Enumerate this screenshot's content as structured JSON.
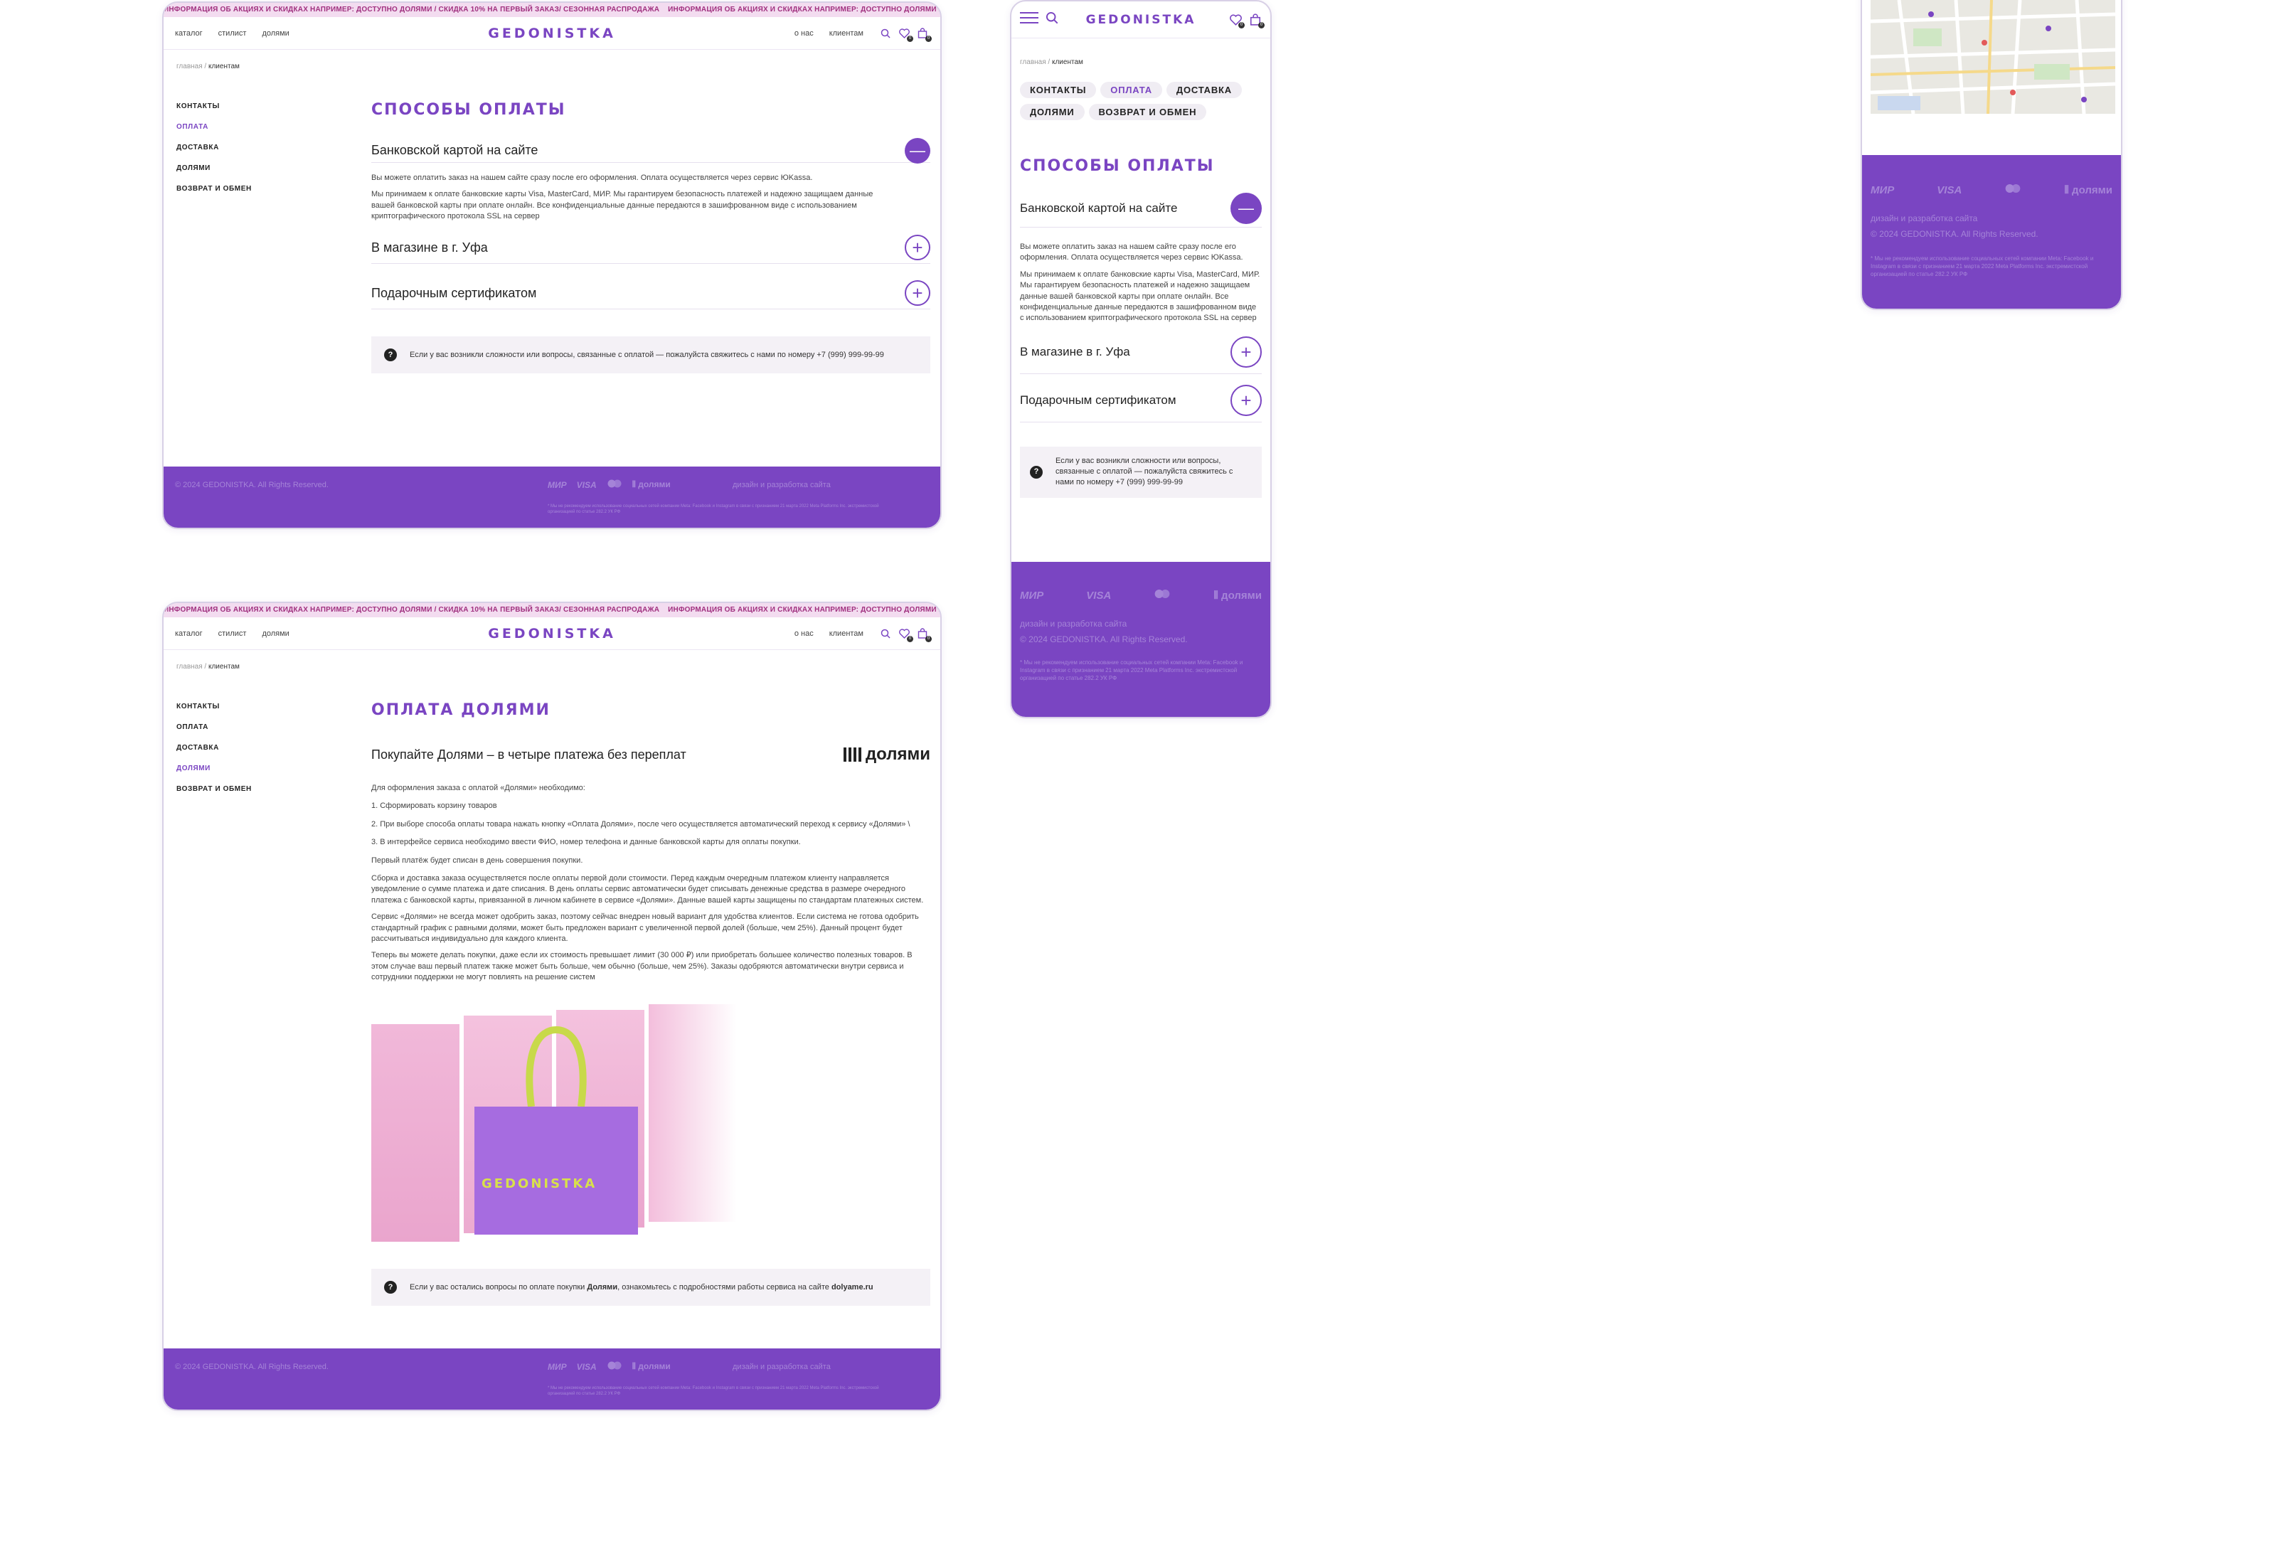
{
  "ticker": {
    "text": "ИНФОРМАЦИЯ ОБ АКЦИЯХ И СКИДКАХ НАПРИМЕР: ДОСТУПНО ДОЛЯМИ / СКИДКА 10% НА ПЕРВЫЙ ЗАКАЗ/ СЕЗОННАЯ РАСПРОДАЖА"
  },
  "header": {
    "logo": "GEDONISTKA",
    "nav": [
      "каталог",
      "стилист",
      "долями"
    ],
    "right_nav": [
      "о нас",
      "клиентам"
    ],
    "wishlist_count": "0",
    "cart_count": "0"
  },
  "breadcrumb": {
    "home": "главная /",
    "current": "клиентам"
  },
  "sidebar": [
    "КОНТАКТЫ",
    "ОПЛАТА",
    "ДОСТАВКА",
    "ДОЛЯМИ",
    "ВОЗВРАТ И ОБМЕН"
  ],
  "payment": {
    "title": "СПОСОБЫ ОПЛАТЫ",
    "acc1_title": "Банковской картой на сайте",
    "acc1_p1": "Вы можете оплатить заказ на нашем сайте сразу после его оформления. Оплата осуществляется через сервис ЮKassa.",
    "acc1_p2": "Мы принимаем к оплате банковские карты Visa, MasterCard, МИР. Мы гарантируем безопасность платежей и надежно защищаем данные вашей банковской карты при оплате онлайн. Все конфиденциальные данные передаются в зашифрованном виде с использованием криптографического протокола SSL на сервер",
    "acc2_title": "В магазине в г. Уфа",
    "acc3_title": "Подарочным  сертификатом",
    "note": "Если у вас возникли сложности или вопросы, связанные с оплатой — пожалуйста свяжитесь с нами по номеру +7 (999) 999-99-99"
  },
  "dolyami": {
    "title": "ОПЛАТА ДОЛЯМИ",
    "subtitle": "Покупайте Долями – в четыре платежа без переплат",
    "logo": "долями",
    "p1": "Для оформления заказа с оплатой «Долями» необходимо:",
    "p2": "1. Сформировать корзину товаров",
    "p3": "2. При выборе способа оплаты товара нажать кнопку «Оплата Долями», после чего осуществляется автоматический переход к сервису «Долями» \\",
    "p4": "3. В интерфейсе сервиса необходимо ввести ФИО, номер телефона и данные банковской карты для оплаты покупки.",
    "p5": "Первый платёж будет списан в день совершения покупки.",
    "p6": "Сборка и доставка заказа осуществляется после оплаты первой доли стоимости. Перед каждым очередным платежом клиенту направляется уведомление о сумме платежа и дате списания. В день оплаты сервис автоматически будет списывать денежные средства в размере очередного платежа с банковской карты, привязанной в личном кабинете в сервисе «Долями». Данные вашей карты защищены по стандартам платежных систем.",
    "p7": "Сервис «Долями» не всегда может одобрить заказ, поэтому сейчас внедрен новый вариант для удобства клиентов. Если система не готова одобрить стандартный график с равными долями, может быть предложен вариант с увеличенной первой долей (больше, чем 25%). Данный процент будет рассчитываться индивидуально для каждого клиента.",
    "p8": "Теперь вы можете делать покупки, даже если их стоимость превышает лимит (30 000 ₽) или приобретать большее количество полезных товаров. В этом случае ваш первый платеж также может быть больше, чем обычно (больше, чем 25%). Заказы одобряются автоматически внутри сервиса и сотрудники поддержки не могут повлиять на решение систем",
    "bag_text": "GEDONISTKA",
    "note_a": "Если у вас остались вопросы по оплате покупки",
    "note_b": "Долями",
    "note_c": ", ознакомьтесь с подробностями работы сервиса на сайте",
    "note_link": "dolyame.ru"
  },
  "footer": {
    "copyright": "© 2024 GEDONISTKA. All Rights Reserved.",
    "pay_logos": [
      "МИР",
      "VISA",
      "долями"
    ],
    "dev": "дизайн и разработка сайта",
    "disclaimer": "* Мы не рекомендуем использование социальных сетей компании Meta: Facebook и Instagram в связи с признанием 21 марта 2022 Meta Platforms Inc. экстремистской организацией по статье 282.2 УК РФ"
  },
  "colors": {
    "brand": "#7a45c2",
    "ticker": "#a0307f",
    "footer": "#7a45c2"
  }
}
